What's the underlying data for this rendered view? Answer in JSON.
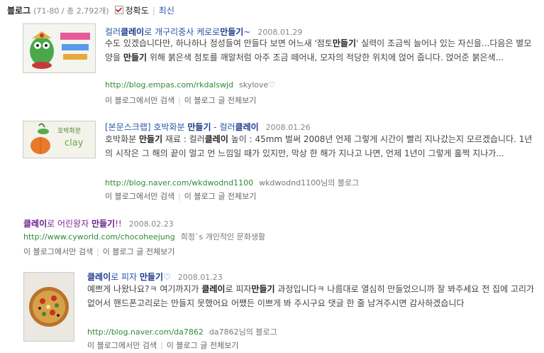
{
  "header": {
    "title": "블로그",
    "range": "(71-80 / 총 2,792개)",
    "sort_accuracy": "정확도",
    "sort_latest": "최신"
  },
  "results": [
    {
      "title_pre": "컬러",
      "title_kw1": "클레이",
      "title_mid": "로 개구리중사 케로로",
      "title_kw2": "만들기",
      "title_post": "~",
      "date": "2008.01.29",
      "desc_a": "수도 있겠습니다만, 하나하나 정성들여 만들다 보면 어느새 '점토",
      "desc_kw1": "만들기",
      "desc_b": "' 실력이 조금씩 늘어나 있는 자신을...다음은 별모양을 ",
      "desc_kw2": "만들기",
      "desc_c": " 위해 붉은색 점토를 깨알처럼 아주 조금 떼어내, 모자의 적당한 위치에 얹어 줍니다. 얹어준 붉은색...",
      "url": "http://blog.empas.com/rkdalswjd",
      "author": "skylove♡",
      "link_this": "이 블로그에서만 검색",
      "link_all": "이 블로그 글 전체보기"
    },
    {
      "title_pre": "[본문스크랩] 호박화분 ",
      "title_kw1": "만들기",
      "title_mid": " - 컬러",
      "title_kw2": "클레이",
      "title_post": "",
      "date": "2008.01.26",
      "desc_a": "호박화분 ",
      "desc_kw1": "만들기",
      "desc_b": " 재료 : 컬러",
      "desc_kw2": "클레이",
      "desc_c": " 높이 : 45mm 벌써 2008년 언제 그렇게 시간이 빨리 지나갔는지 모르겠습니다. 1년의 시작은 그 해의 끝이 멀고 먼 느낌일 때가 있지만, 막상 한 해가 지나고 나면, 언제 1년이 그렇게 훌쩍 지나가...",
      "url": "http://blog.naver.com/wkdwodnd1100",
      "author": "wkdwodnd1100님의 블로그",
      "link_this": "이 블로그에서만 검색",
      "link_all": "이 블로그 글 전체보기"
    },
    {
      "title_kw1": "클레이",
      "title_mid": "로 어린왕자 ",
      "title_kw2": "만들기",
      "title_post": "!!",
      "date": "2008.02.23",
      "url": "http://www.cyworld.com/chocoheejung",
      "author": "희정`s 개인적인 문화생활",
      "link_this": "이 블로그에서만 검색",
      "link_all": "이 블로그 글 전체보기"
    },
    {
      "title_kw1": "클레이",
      "title_mid": "로 피자 ",
      "title_kw2": "만들기",
      "title_post": "♡",
      "date": "2008.01.23",
      "desc_a": "예쁘게 나왔나요?ㅋ 여기까지가 ",
      "desc_kw1": "클레이",
      "desc_b": "로 피자",
      "desc_kw2": "만들기",
      "desc_c": " 과정입니다ㅋ 나름대로 열심히 만들었으니까 잘 봐주세요 전 집에 고리가 없어서 핸드폰고리로는 만들지 못했어요 어쨌든 이쁘게 봐 주시구요 댓글 한 줄 남겨주시면 감사하겠습니다",
      "url": "http://blog.naver.com/da7862",
      "author": "da7862님의 블로그",
      "link_this": "이 블로그에서만 검색",
      "link_all": "이 블로그 글 전체보기"
    }
  ]
}
